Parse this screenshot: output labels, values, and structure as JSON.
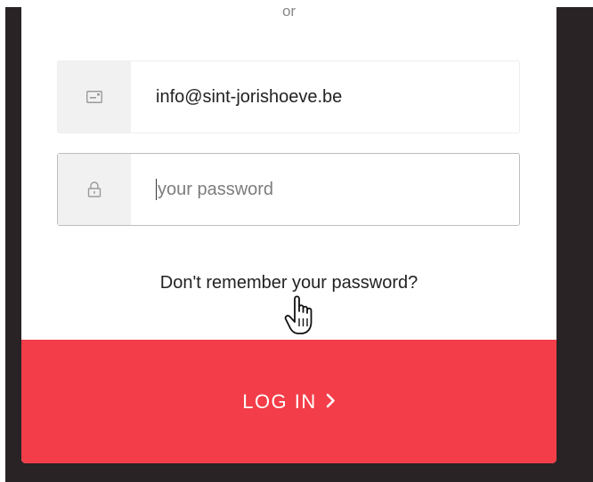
{
  "divider": {
    "text": "or"
  },
  "email": {
    "value": "info@sint-jorishoeve.be",
    "icon": "id-card-icon"
  },
  "password": {
    "placeholder": "your password",
    "icon": "lock-icon"
  },
  "forgot_link": {
    "label": "Don't remember your password?"
  },
  "login_button": {
    "label": "LOG IN",
    "icon": "chevron-right-icon"
  },
  "colors": {
    "accent": "#f33d48",
    "background": "#2a2326",
    "panel": "#ffffff",
    "field_icon_bg": "#f1f1f1"
  }
}
